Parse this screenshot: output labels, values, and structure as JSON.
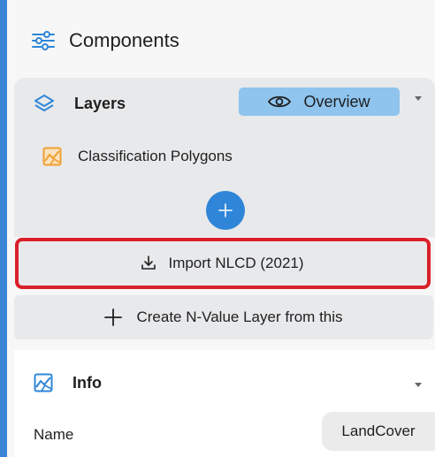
{
  "header": {
    "title": "Components",
    "icon": "sliders-icon"
  },
  "layers": {
    "title": "Layers",
    "icon": "layers-icon",
    "view_mode": "Overview",
    "items": [
      {
        "label": "Classification Polygons",
        "icon": "polygon-map-icon"
      }
    ],
    "add_icon": "plus-icon"
  },
  "actions": {
    "import_label": "Import NLCD (2021)",
    "create_label": "Create N-Value Layer from this"
  },
  "info": {
    "title": "Info",
    "icon": "map-icon",
    "name_label": "Name",
    "name_value": "LandCover"
  },
  "colors": {
    "accent": "#2f86d8",
    "overview_bg": "#8ec4ee",
    "highlight": "#d9202a",
    "polygon_icon": "#f0a030"
  }
}
